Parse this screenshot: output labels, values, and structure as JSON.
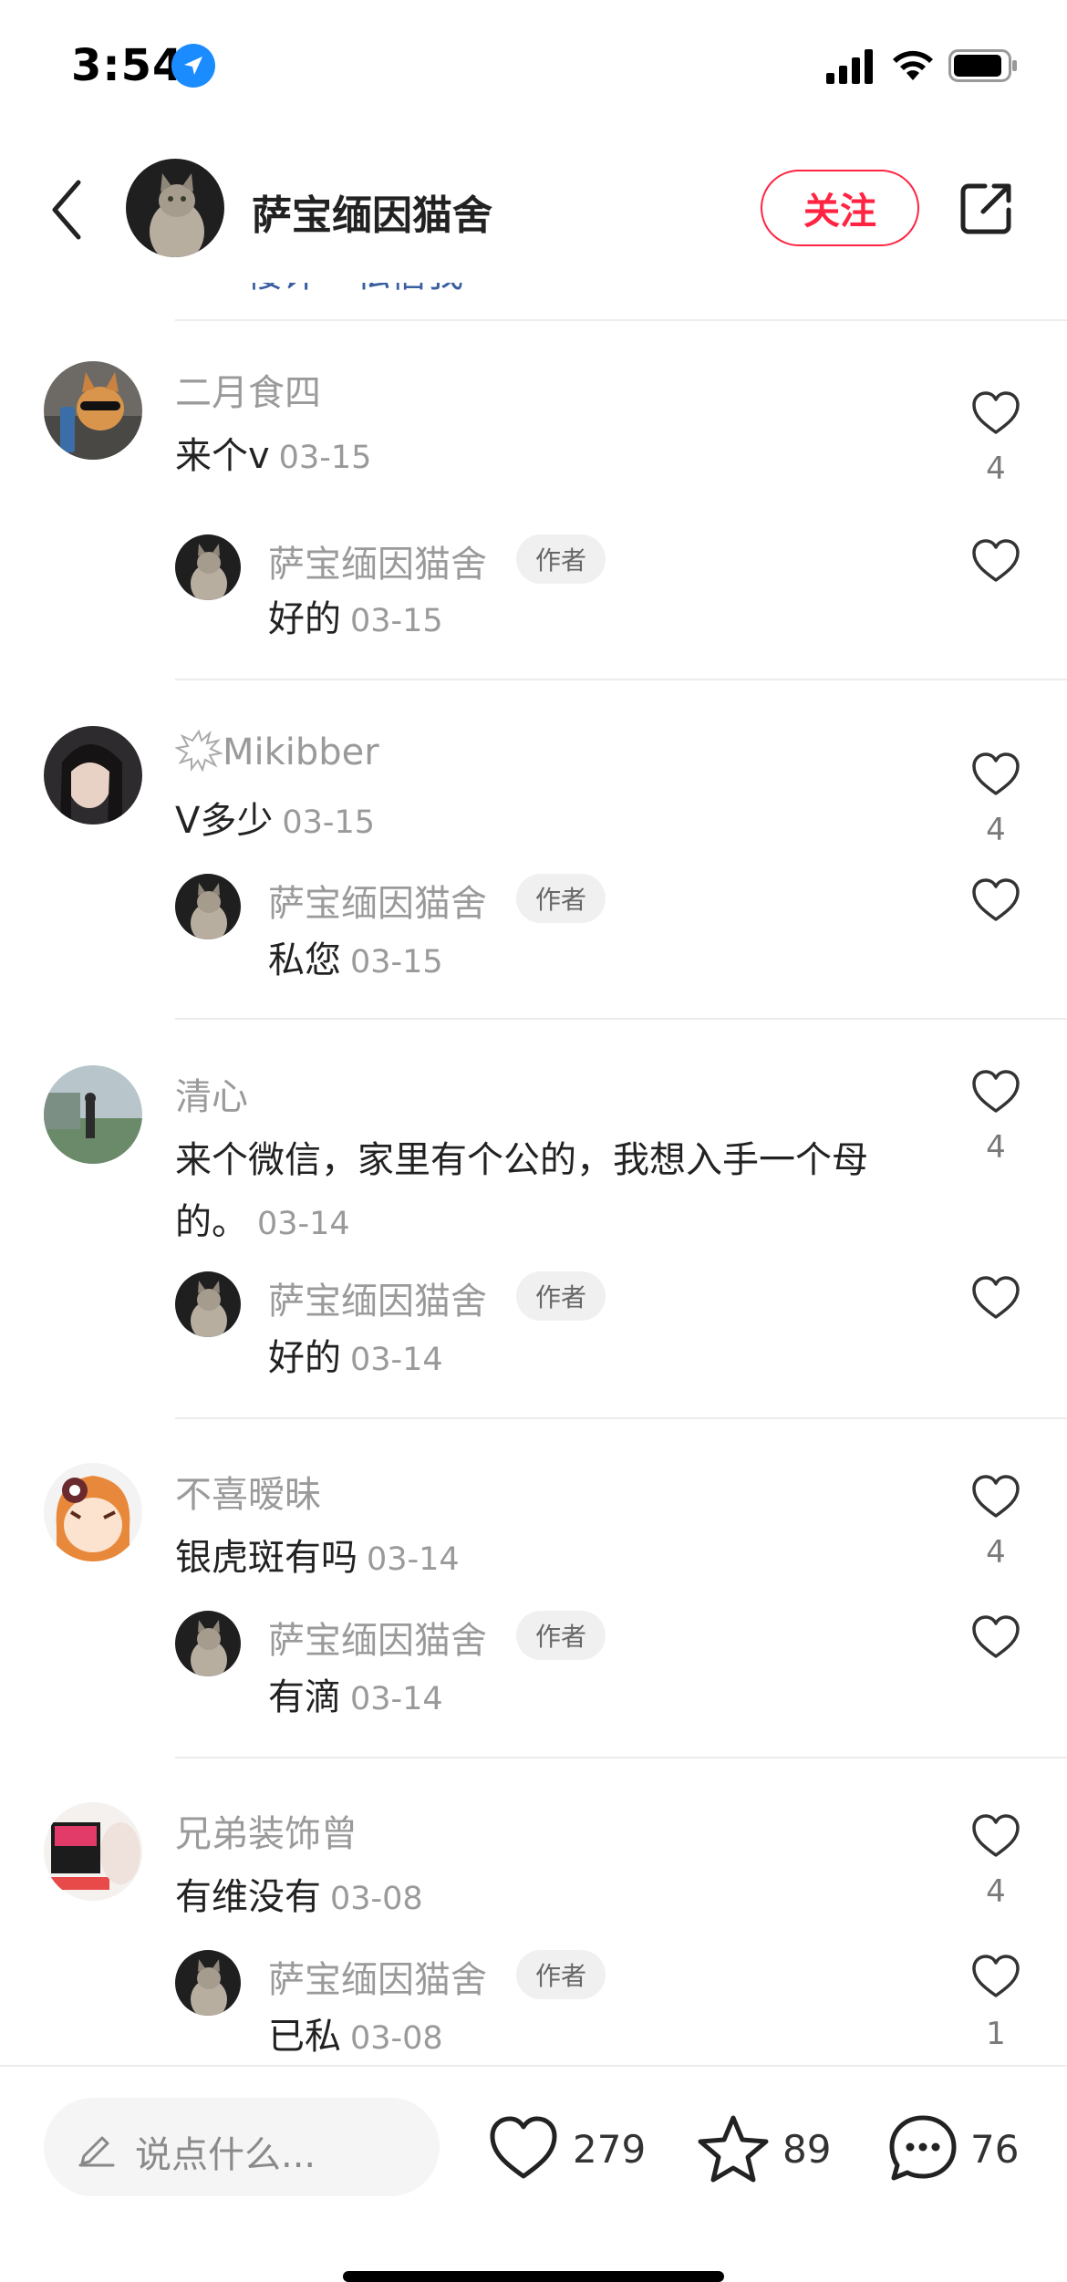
{
  "status_bar": {
    "time": "3:54"
  },
  "header": {
    "title": "萨宝缅因猫舍",
    "follow_label": "关注"
  },
  "cut_off_text": "楼评 · 私信我",
  "comments": [
    {
      "name": "二月食四",
      "text": "来个v",
      "date": "03-15",
      "likes": "4",
      "reply": {
        "name": "萨宝缅因猫舍",
        "tag": "作者",
        "text": "好的",
        "date": "03-15",
        "likes": ""
      }
    },
    {
      "name": "Mikibber",
      "text": "V多少",
      "date": "03-15",
      "likes": "4",
      "reply": {
        "name": "萨宝缅因猫舍",
        "tag": "作者",
        "text": "私您",
        "date": "03-15",
        "likes": ""
      }
    },
    {
      "name": "清心",
      "text": "来个微信，家里有个公的，我想入手一个母的。",
      "date": "03-14",
      "likes": "4",
      "reply": {
        "name": "萨宝缅因猫舍",
        "tag": "作者",
        "text": "好的",
        "date": "03-14",
        "likes": ""
      }
    },
    {
      "name": "不喜暧昧",
      "text": "银虎斑有吗",
      "date": "03-14",
      "likes": "4",
      "reply": {
        "name": "萨宝缅因猫舍",
        "tag": "作者",
        "text": "有滴",
        "date": "03-14",
        "likes": ""
      }
    },
    {
      "name": "兄弟装饰曾",
      "text": "有维没有",
      "date": "03-08",
      "likes": "4",
      "reply": {
        "name": "萨宝缅因猫舍",
        "tag": "作者",
        "text": "已私",
        "date": "03-08",
        "likes": "1"
      }
    }
  ],
  "bottom_bar": {
    "input_placeholder": "说点什么...",
    "like_count": "279",
    "star_count": "89",
    "comment_count": "76"
  },
  "colors": {
    "accent": "#ff2442",
    "muted_text": "#9a9a9a",
    "text": "#222222"
  },
  "icons": [
    "location-icon",
    "signal-icon",
    "wifi-icon",
    "battery-icon",
    "back-icon",
    "share-icon",
    "heart-icon",
    "star-icon",
    "comment-icon",
    "pen-icon"
  ]
}
